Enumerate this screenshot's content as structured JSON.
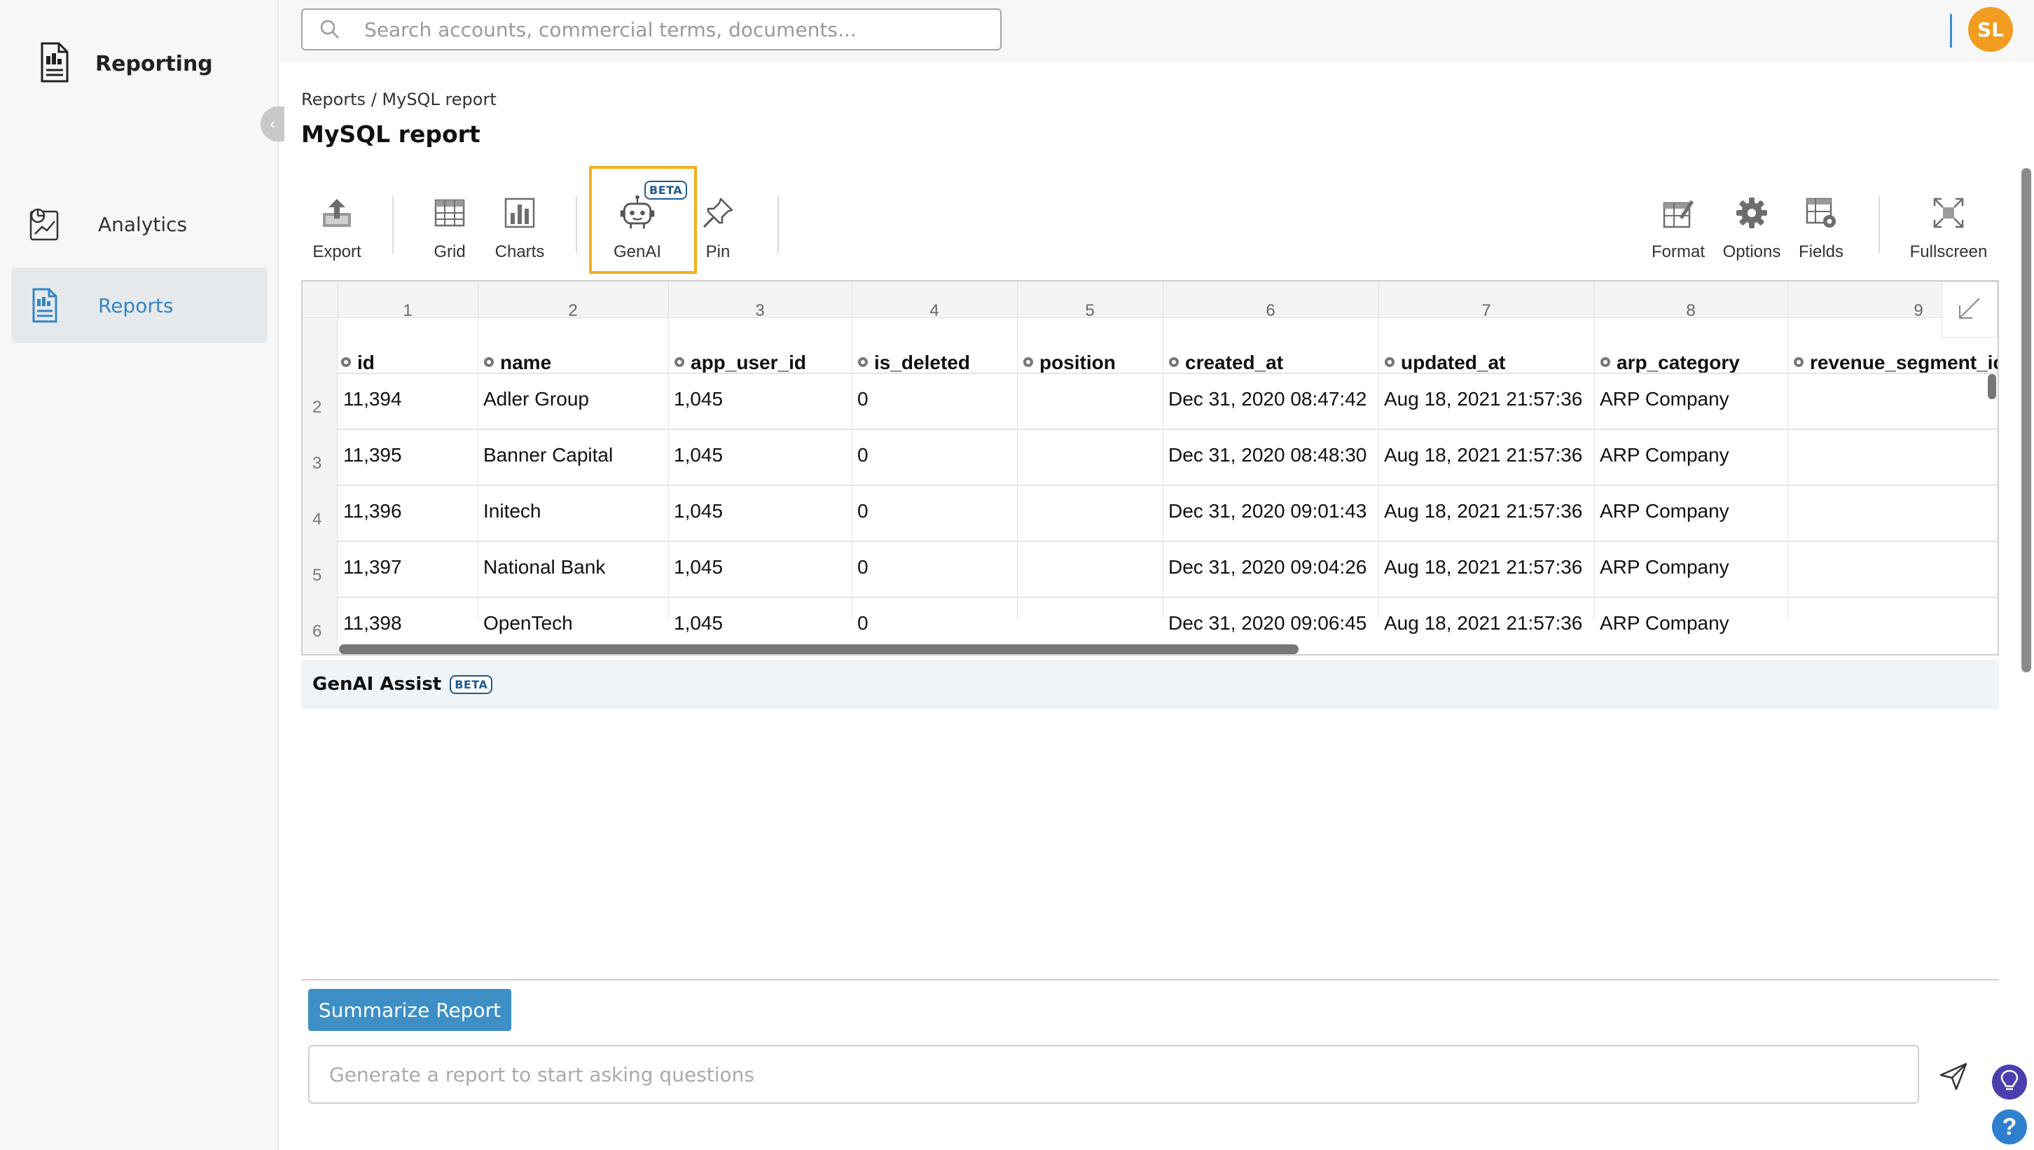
{
  "sidebar": {
    "brand": "Reporting",
    "collapse_icon": "chevron-left-icon",
    "items": [
      {
        "label": "Analytics",
        "icon": "analytics-icon",
        "active": false
      },
      {
        "label": "Reports",
        "icon": "report-document-icon",
        "active": true
      }
    ]
  },
  "topbar": {
    "search_placeholder": "Search accounts, commercial terms, documents...",
    "avatar_initials": "SL",
    "avatar_color": "#f29d1f"
  },
  "breadcrumb": "Reports / MySQL report",
  "page_title": "MySQL report",
  "toolbar": {
    "export": "Export",
    "grid": "Grid",
    "charts": "Charts",
    "genai": "GenAI",
    "genai_badge": "BETA",
    "pin": "Pin",
    "format": "Format",
    "options": "Options",
    "fields": "Fields",
    "fullscreen": "Fullscreen"
  },
  "grid": {
    "column_numbers": [
      "1",
      "2",
      "3",
      "4",
      "5",
      "6",
      "7",
      "8",
      "9"
    ],
    "headers": [
      "id",
      "name",
      "app_user_id",
      "is_deleted",
      "position",
      "created_at",
      "updated_at",
      "arp_category",
      "revenue_segment_ic"
    ],
    "row_numbers": [
      "2",
      "3",
      "4",
      "5",
      "6"
    ],
    "rows": [
      [
        "11,394",
        "Adler Group",
        "1,045",
        "0",
        "",
        "Dec 31, 2020 08:47:42",
        "Aug 18, 2021 21:57:36",
        "ARP Company",
        ""
      ],
      [
        "11,395",
        "Banner Capital",
        "1,045",
        "0",
        "",
        "Dec 31, 2020 08:48:30",
        "Aug 18, 2021 21:57:36",
        "ARP Company",
        ""
      ],
      [
        "11,396",
        "Initech",
        "1,045",
        "0",
        "",
        "Dec 31, 2020 09:01:43",
        "Aug 18, 2021 21:57:36",
        "ARP Company",
        ""
      ],
      [
        "11,397",
        "National Bank",
        "1,045",
        "0",
        "",
        "Dec 31, 2020 09:04:26",
        "Aug 18, 2021 21:57:36",
        "ARP Company",
        ""
      ],
      [
        "11,398",
        "OpenTech",
        "1,045",
        "0",
        "",
        "Dec 31, 2020 09:06:45",
        "Aug 18, 2021 21:57:36",
        "ARP Company",
        ""
      ]
    ]
  },
  "assist": {
    "title": "GenAI Assist",
    "badge": "BETA",
    "summarize_label": "Summarize Report",
    "input_placeholder": "Generate a report to start asking questions"
  },
  "colors": {
    "accent": "#3d8fc6",
    "highlight": "#f5b01c",
    "active_nav_text": "#3585c7"
  }
}
